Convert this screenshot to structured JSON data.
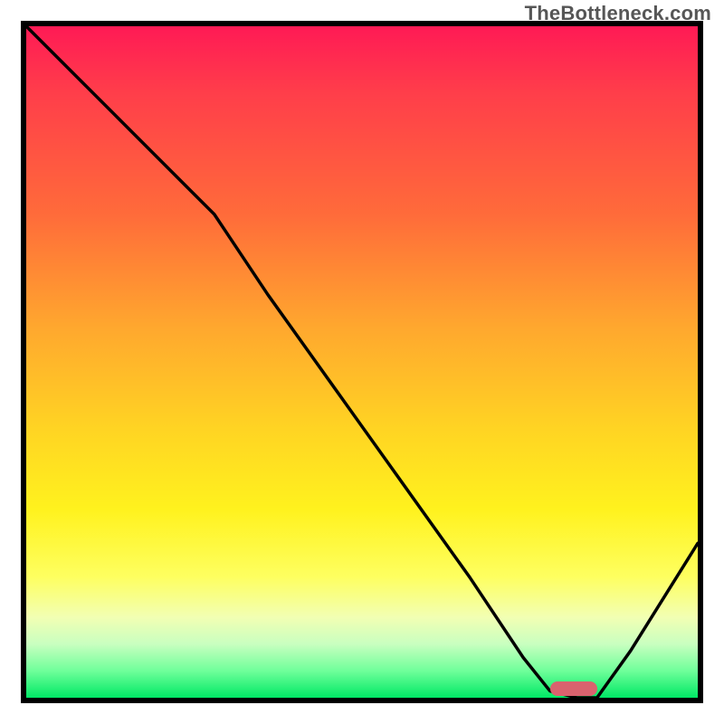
{
  "watermark_text": "TheBottleneck.com",
  "colors": {
    "frame": "#000000",
    "curve": "#000000",
    "marker": "#d9626e",
    "gradient_top": "#ff1a55",
    "gradient_mid": "#ffd423",
    "gradient_bottom": "#00e865"
  },
  "chart_data": {
    "type": "line",
    "title": "",
    "xlabel": "",
    "ylabel": "",
    "xlim": [
      0,
      100
    ],
    "ylim": [
      0,
      100
    ],
    "grid": false,
    "legend": false,
    "comment": "x = normalized horizontal position 0-100 (left→right); y = normalized mismatch/bottleneck 0-100 (0 = optimal/green, 100 = worst/red). Curve descends from top-left, reaches a flat minimum near x≈78–85, then rises toward the right edge. A small rounded marker sits on the flat minimum.",
    "series": [
      {
        "name": "bottleneck-curve",
        "x": [
          0,
          8,
          16,
          24,
          28,
          36,
          46,
          56,
          66,
          74,
          78,
          82,
          85,
          90,
          95,
          100
        ],
        "y": [
          100,
          92,
          84,
          76,
          72,
          60,
          46,
          32,
          18,
          6,
          1,
          0,
          0,
          7,
          15,
          23
        ]
      }
    ],
    "marker": {
      "x_start": 78,
      "x_end": 85,
      "y": 0
    }
  }
}
